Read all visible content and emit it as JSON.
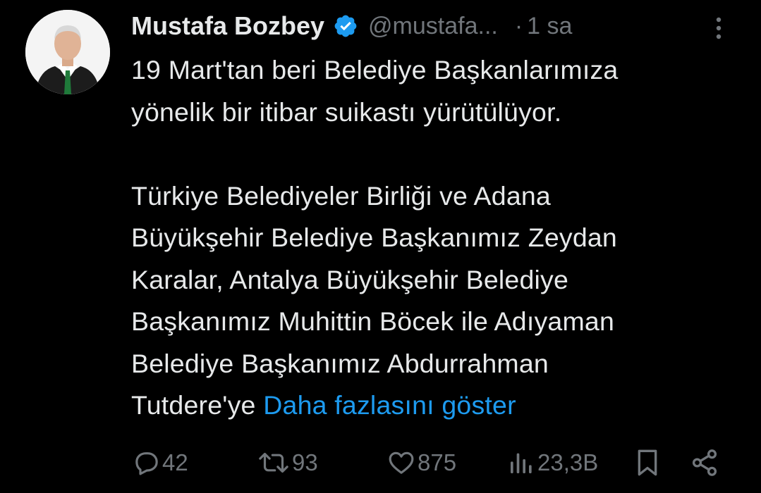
{
  "tweet": {
    "author_name": "Mustafa Bozbey",
    "handle": "@mustafa...",
    "dot": "·",
    "time": "1 sa",
    "lines": [
      "19 Mart'tan beri Belediye Başkanlarımıza",
      "yönelik bir itibar suikastı yürütülüyor.",
      "Türkiye Belediyeler Birliği ve Adana",
      "Büyükşehir Belediye Başkanımız Zeydan",
      "Karalar, Antalya Büyükşehir Belediye",
      "Başkanımız Muhittin Böcek ile Adıyaman",
      "Belediye Başkanımız Abdurrahman",
      "Tutdere'ye"
    ],
    "show_more": "Daha fazlasını göster"
  },
  "actions": {
    "replies": "42",
    "reposts": "93",
    "likes": "875",
    "views": "23,3B"
  },
  "colors": {
    "background": "#000000",
    "text": "#e7e9ea",
    "muted": "#71767b",
    "link": "#1d9bf0",
    "verified": "#1d9bf0"
  },
  "icons": {
    "avatar": "avatar",
    "verified": "verified-badge-icon",
    "more": "more-vertical-icon",
    "reply": "reply-icon",
    "repost": "repost-icon",
    "like": "heart-icon",
    "views": "views-icon",
    "bookmark": "bookmark-icon",
    "share": "share-icon"
  }
}
